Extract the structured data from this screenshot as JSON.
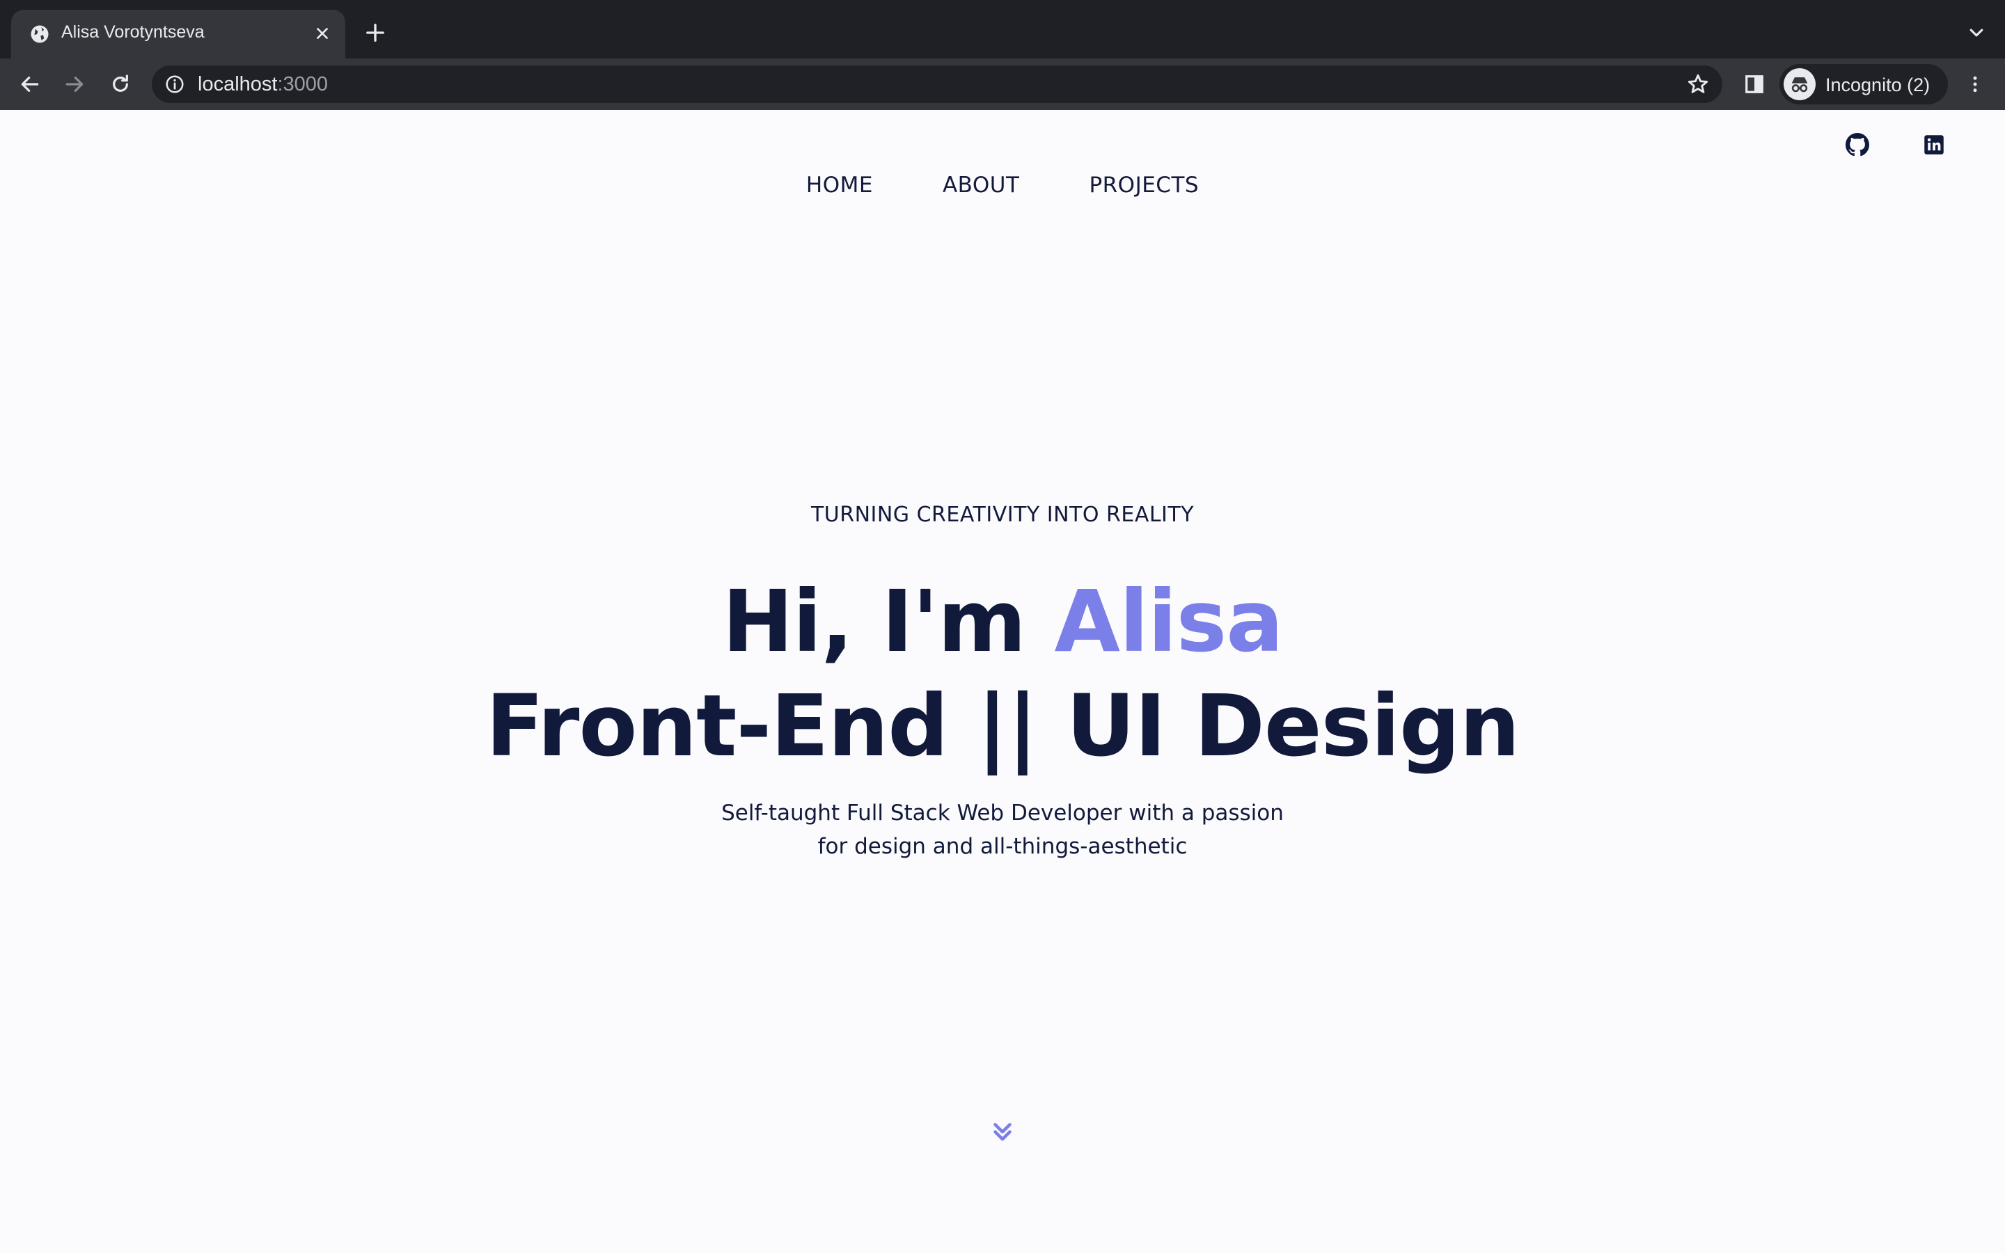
{
  "browser": {
    "tab_title": "Alisa Vorotyntseva",
    "url_host": "localhost",
    "url_port": ":3000",
    "profile_label": "Incognito (2)"
  },
  "icons": {
    "tab_favicon": "globe-icon",
    "tab_close": "close-icon",
    "new_tab": "plus-icon",
    "tab_list": "chevron-down-icon",
    "back": "arrow-left-icon",
    "forward": "arrow-right-icon",
    "reload": "reload-icon",
    "site_info": "info-icon",
    "bookmark": "star-icon",
    "side_panel": "side-panel-icon",
    "incognito": "incognito-icon",
    "menu": "kebab-menu-icon",
    "github": "github-icon",
    "linkedin": "linkedin-icon",
    "scroll_down": "double-chevron-down-icon"
  },
  "nav": {
    "items": [
      {
        "label": "HOME"
      },
      {
        "label": "ABOUT"
      },
      {
        "label": "PROJECTS"
      }
    ]
  },
  "hero": {
    "tagline": "TURNING CREATIVITY INTO REALITY",
    "greeting": "Hi, I'm ",
    "name": "Alisa",
    "role": "Front-End || UI Design",
    "subtitle_line1": "Self-taught Full Stack Web Developer with a passion",
    "subtitle_line2": "for design and all-things-aesthetic"
  },
  "colors": {
    "chrome_dark": "#1f2025",
    "chrome_toolbar": "#35363b",
    "page_background": "#fbfbfe",
    "text_navy": "#121a3b",
    "accent": "#7b7fe8"
  }
}
